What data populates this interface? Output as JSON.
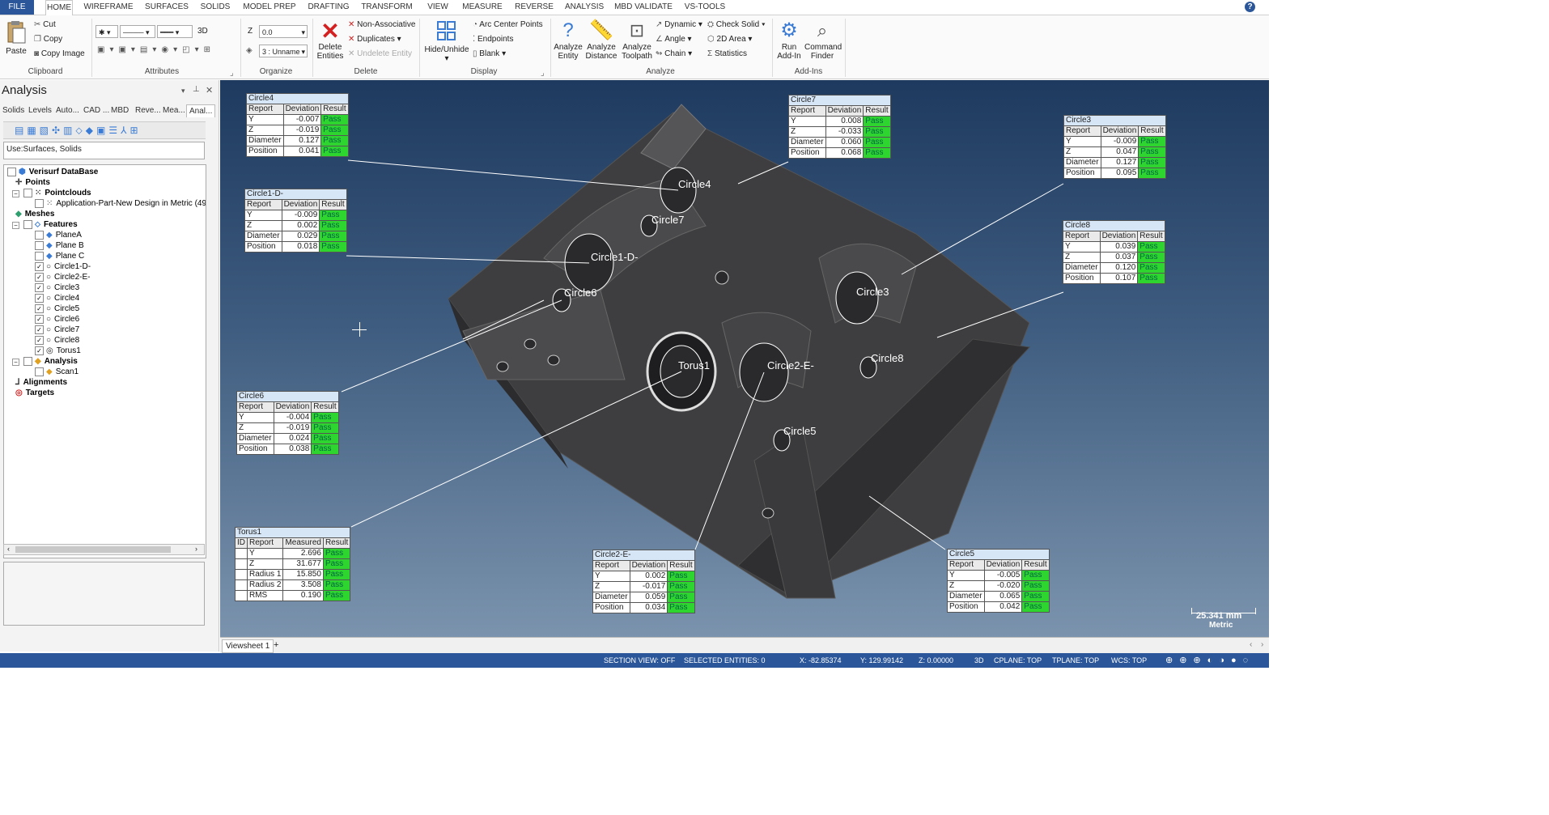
{
  "menu_tabs": [
    "FILE",
    "HOME",
    "WIREFRAME",
    "SURFACES",
    "SOLIDS",
    "MODEL PREP",
    "DRAFTING",
    "TRANSFORM",
    "VIEW",
    "MEASURE",
    "REVERSE",
    "ANALYSIS",
    "MBD VALIDATE",
    "VS-TOOLS"
  ],
  "ribbon": {
    "clipboard": {
      "paste": "Paste",
      "cut": "Cut",
      "copy": "Copy",
      "copy_image": "Copy Image",
      "label": "Clipboard"
    },
    "attributes": {
      "label": "Attributes",
      "mode3d": "3D"
    },
    "organize": {
      "label": "Organize",
      "z_label": "Z",
      "z_value": "0.0",
      "level_value": "3 : Unname"
    },
    "delete": {
      "label": "Delete",
      "delete_entities": "Delete Entities",
      "non_associative": "Non-Associative",
      "duplicates": "Duplicates",
      "undelete_entity": "Undelete Entity"
    },
    "display": {
      "label": "Display",
      "hide_unhide": "Hide/Unhide",
      "arc_center_points": "Arc Center Points",
      "endpoints": "Endpoints",
      "blank": "Blank"
    },
    "analyze": {
      "label": "Analyze",
      "analyze_entity": "Analyze Entity",
      "analyze_distance": "Analyze Distance",
      "analyze_toolpath": "Analyze Toolpath",
      "dynamic": "Dynamic",
      "angle": "Angle",
      "chain": "Chain",
      "check_solid": "Check Solid",
      "area_2d": "2D Area",
      "statistics": "Statistics"
    },
    "addins": {
      "label": "Add-Ins",
      "run_addin": "Run Add-In",
      "command_finder": "Command Finder"
    }
  },
  "panel": {
    "title": "Analysis",
    "tabs": [
      "Solids",
      "Levels",
      "Auto...",
      "CAD ...",
      "MBD",
      "Reve...",
      "Mea...",
      "Anal..."
    ],
    "use_text": "Use:Surfaces, Solids",
    "tree": [
      {
        "label": "Verisurf DataBase",
        "bold": true
      },
      {
        "label": "Points",
        "bold": true
      },
      {
        "label": "Pointclouds",
        "bold": true
      },
      {
        "label": "Application-Part-New Design in Metric (49",
        "bold": false
      },
      {
        "label": "Meshes",
        "bold": true
      },
      {
        "label": "Features",
        "bold": true
      },
      {
        "label": "PlaneA",
        "bold": false
      },
      {
        "label": "Plane B",
        "bold": false
      },
      {
        "label": "Plane C",
        "bold": false
      },
      {
        "label": "Circle1-D-",
        "bold": false
      },
      {
        "label": "Circle2-E-",
        "bold": false
      },
      {
        "label": "Circle3",
        "bold": false
      },
      {
        "label": "Circle4",
        "bold": false
      },
      {
        "label": "Circle5",
        "bold": false
      },
      {
        "label": "Circle6",
        "bold": false
      },
      {
        "label": "Circle7",
        "bold": false
      },
      {
        "label": "Circle8",
        "bold": false
      },
      {
        "label": "Torus1",
        "bold": false
      },
      {
        "label": "Analysis",
        "bold": true
      },
      {
        "label": "Scan1",
        "bold": false
      },
      {
        "label": "Alignments",
        "bold": true
      },
      {
        "label": "Targets",
        "bold": true
      }
    ]
  },
  "reports": [
    {
      "name": "Circle4",
      "headers": [
        "Report",
        "Deviation",
        "Result"
      ],
      "rows": [
        [
          "Y",
          "-0.007",
          "Pass"
        ],
        [
          "Z",
          "-0.019",
          "Pass"
        ],
        [
          "Diameter",
          "0.127",
          "Pass"
        ],
        [
          "Position",
          "0.041",
          "Pass"
        ]
      ]
    },
    {
      "name": "Circle7",
      "headers": [
        "Report",
        "Deviation",
        "Result"
      ],
      "rows": [
        [
          "Y",
          "0.008",
          "Pass"
        ],
        [
          "Z",
          "-0.033",
          "Pass"
        ],
        [
          "Diameter",
          "0.060",
          "Pass"
        ],
        [
          "Position",
          "0.068",
          "Pass"
        ]
      ]
    },
    {
      "name": "Circle3",
      "headers": [
        "Report",
        "Deviation",
        "Result"
      ],
      "rows": [
        [
          "Y",
          "-0.009",
          "Pass"
        ],
        [
          "Z",
          "0.047",
          "Pass"
        ],
        [
          "Diameter",
          "0.127",
          "Pass"
        ],
        [
          "Position",
          "0.095",
          "Pass"
        ]
      ]
    },
    {
      "name": "Circle1-D-",
      "headers": [
        "Report",
        "Deviation",
        "Result"
      ],
      "rows": [
        [
          "Y",
          "-0.009",
          "Pass"
        ],
        [
          "Z",
          "0.002",
          "Pass"
        ],
        [
          "Diameter",
          "0.029",
          "Pass"
        ],
        [
          "Position",
          "0.018",
          "Pass"
        ]
      ]
    },
    {
      "name": "Circle8",
      "headers": [
        "Report",
        "Deviation",
        "Result"
      ],
      "rows": [
        [
          "Y",
          "0.039",
          "Pass"
        ],
        [
          "Z",
          "0.037",
          "Pass"
        ],
        [
          "Diameter",
          "0.120",
          "Pass"
        ],
        [
          "Position",
          "0.107",
          "Pass"
        ]
      ]
    },
    {
      "name": "Circle6",
      "headers": [
        "Report",
        "Deviation",
        "Result"
      ],
      "rows": [
        [
          "Y",
          "-0.004",
          "Pass"
        ],
        [
          "Z",
          "-0.019",
          "Pass"
        ],
        [
          "Diameter",
          "0.024",
          "Pass"
        ],
        [
          "Position",
          "0.038",
          "Pass"
        ]
      ]
    },
    {
      "name": "Torus1",
      "headers": [
        "ID",
        "Report",
        "Measured",
        "Result"
      ],
      "rows": [
        [
          "",
          "Y",
          "2.696",
          "Pass"
        ],
        [
          "",
          "Z",
          "31.677",
          "Pass"
        ],
        [
          "",
          "Radius 1",
          "15.850",
          "Pass"
        ],
        [
          "",
          "Radius 2",
          "3.508",
          "Pass"
        ],
        [
          "",
          "RMS",
          "0.190",
          "Pass"
        ]
      ]
    },
    {
      "name": "Circle2-E-",
      "headers": [
        "Report",
        "Deviation",
        "Result"
      ],
      "rows": [
        [
          "Y",
          "0.002",
          "Pass"
        ],
        [
          "Z",
          "-0.017",
          "Pass"
        ],
        [
          "Diameter",
          "0.059",
          "Pass"
        ],
        [
          "Position",
          "0.034",
          "Pass"
        ]
      ]
    },
    {
      "name": "Circle5",
      "headers": [
        "Report",
        "Deviation",
        "Result"
      ],
      "rows": [
        [
          "Y",
          "-0.005",
          "Pass"
        ],
        [
          "Z",
          "-0.020",
          "Pass"
        ],
        [
          "Diameter",
          "0.065",
          "Pass"
        ],
        [
          "Position",
          "0.042",
          "Pass"
        ]
      ]
    }
  ],
  "feature_labels": [
    "Circle4",
    "Circle7",
    "Circle1-D-",
    "Circle6",
    "Circle3",
    "Circle8",
    "Torus1",
    "Circle2-E-",
    "Circle5"
  ],
  "scale": {
    "value": "25.341 mm",
    "units": "Metric"
  },
  "sheet_tab": "Viewsheet 1",
  "sheet_add": "+",
  "status": {
    "section_view": "SECTION VIEW: OFF",
    "selected": "SELECTED ENTITIES: 0",
    "x": "X:  -82.85374",
    "y": "Y:  129.99142",
    "z": "Z:  0.00000",
    "mode": "3D",
    "cplane": "CPLANE: TOP",
    "tplane": "TPLANE: TOP",
    "wcs": "WCS: TOP"
  },
  "colors": {
    "pass": "#2fd52f",
    "accent": "#2b579a"
  }
}
